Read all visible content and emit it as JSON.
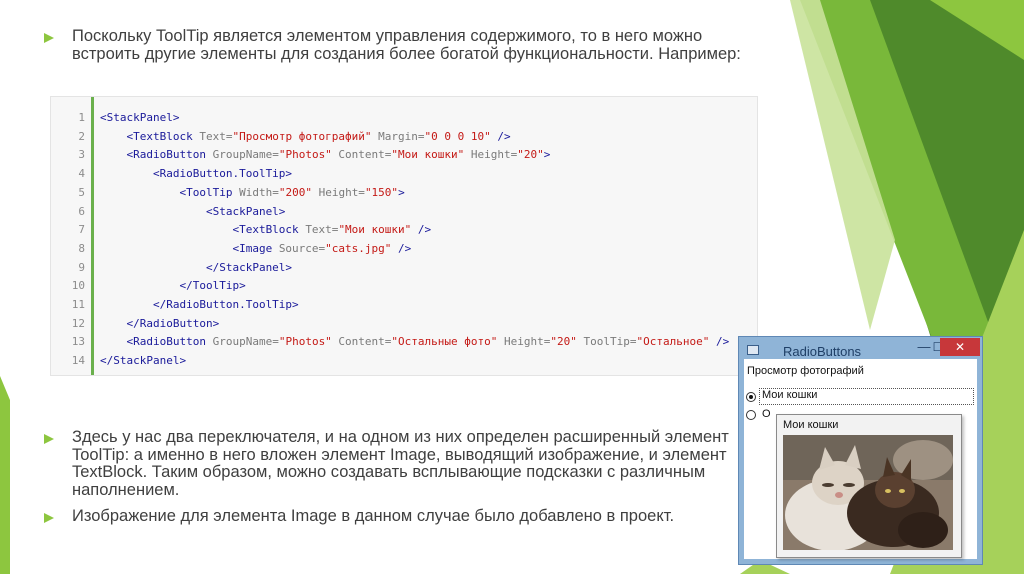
{
  "bullets": [
    {
      "text": "Поскольку ToolTip является элементом управления содержимого, то в него можно встроить другие элементы для создания более богатой функциональности. Например:"
    },
    {
      "text": "Здесь у нас два переключателя, и на одном из них определен расширенный элемент ToolTip: а именно в него вложен элемент Image, выводящий изображение, и элемент TextBlock. Таким образом, можно создавать всплывающие подсказки с различным наполнением."
    },
    {
      "text": "Изображение для элемента Image в данном случае было добавлено в проект."
    }
  ],
  "code": {
    "line_numbers": [
      "1",
      "2",
      "3",
      "4",
      "5",
      "6",
      "7",
      "8",
      "9",
      "10",
      "11",
      "12",
      "13",
      "14"
    ],
    "lines": [
      [
        {
          "c": "t",
          "s": "<StackPanel>"
        }
      ],
      [
        {
          "c": "t",
          "s": "    <TextBlock "
        },
        {
          "c": "a",
          "s": "Text="
        },
        {
          "c": "v",
          "s": "\"Просмотр фотографий\""
        },
        {
          "c": "a",
          "s": " Margin="
        },
        {
          "c": "v",
          "s": "\"0 0 0 10\""
        },
        {
          "c": "t",
          "s": " />"
        }
      ],
      [
        {
          "c": "t",
          "s": "    <RadioButton "
        },
        {
          "c": "a",
          "s": "GroupName="
        },
        {
          "c": "v",
          "s": "\"Photos\""
        },
        {
          "c": "a",
          "s": " Content="
        },
        {
          "c": "v",
          "s": "\"Мои кошки\""
        },
        {
          "c": "a",
          "s": " Height="
        },
        {
          "c": "v",
          "s": "\"20\""
        },
        {
          "c": "t",
          "s": ">"
        }
      ],
      [
        {
          "c": "t",
          "s": "        <RadioButton.ToolTip>"
        }
      ],
      [
        {
          "c": "t",
          "s": "            <ToolTip "
        },
        {
          "c": "a",
          "s": "Width="
        },
        {
          "c": "v",
          "s": "\"200\""
        },
        {
          "c": "a",
          "s": " Height="
        },
        {
          "c": "v",
          "s": "\"150\""
        },
        {
          "c": "t",
          "s": ">"
        }
      ],
      [
        {
          "c": "t",
          "s": "                <StackPanel>"
        }
      ],
      [
        {
          "c": "t",
          "s": "                    <TextBlock "
        },
        {
          "c": "a",
          "s": "Text="
        },
        {
          "c": "v",
          "s": "\"Мои кошки\""
        },
        {
          "c": "t",
          "s": " />"
        }
      ],
      [
        {
          "c": "t",
          "s": "                    <Image "
        },
        {
          "c": "a",
          "s": "Source="
        },
        {
          "c": "v",
          "s": "\"cats.jpg\""
        },
        {
          "c": "t",
          "s": " />"
        }
      ],
      [
        {
          "c": "t",
          "s": "                </StackPanel>"
        }
      ],
      [
        {
          "c": "t",
          "s": "            </ToolTip>"
        }
      ],
      [
        {
          "c": "t",
          "s": "        </RadioButton.ToolTip>"
        }
      ],
      [
        {
          "c": "t",
          "s": "    </RadioButton>"
        }
      ],
      [
        {
          "c": "t",
          "s": "    <RadioButton "
        },
        {
          "c": "a",
          "s": "GroupName="
        },
        {
          "c": "v",
          "s": "\"Photos\""
        },
        {
          "c": "a",
          "s": " Content="
        },
        {
          "c": "v",
          "s": "\"Остальные фото\""
        },
        {
          "c": "a",
          "s": " Height="
        },
        {
          "c": "v",
          "s": "\"20\""
        },
        {
          "c": "a",
          "s": " ToolTip="
        },
        {
          "c": "v",
          "s": "\"Остальное\""
        },
        {
          "c": "t",
          "s": " />"
        }
      ],
      [
        {
          "c": "t",
          "s": "</StackPanel>"
        }
      ]
    ]
  },
  "window": {
    "title": "RadioButtons",
    "minimize_glyph": "—",
    "maximize_glyph": "☐",
    "close_glyph": "✕",
    "heading": "Просмотр фотографий",
    "radio1_label": "Мои кошки",
    "radio2_label": "О",
    "tooltip_text": "Мои кошки"
  },
  "colors": {
    "accent_green": "#8dc63f",
    "dark_green": "#4f8a2b",
    "bullet": "#8dc63f"
  },
  "icons": [
    "triangle-bullet-icon",
    "window-icon",
    "minimize-icon",
    "maximize-icon",
    "close-icon"
  ]
}
